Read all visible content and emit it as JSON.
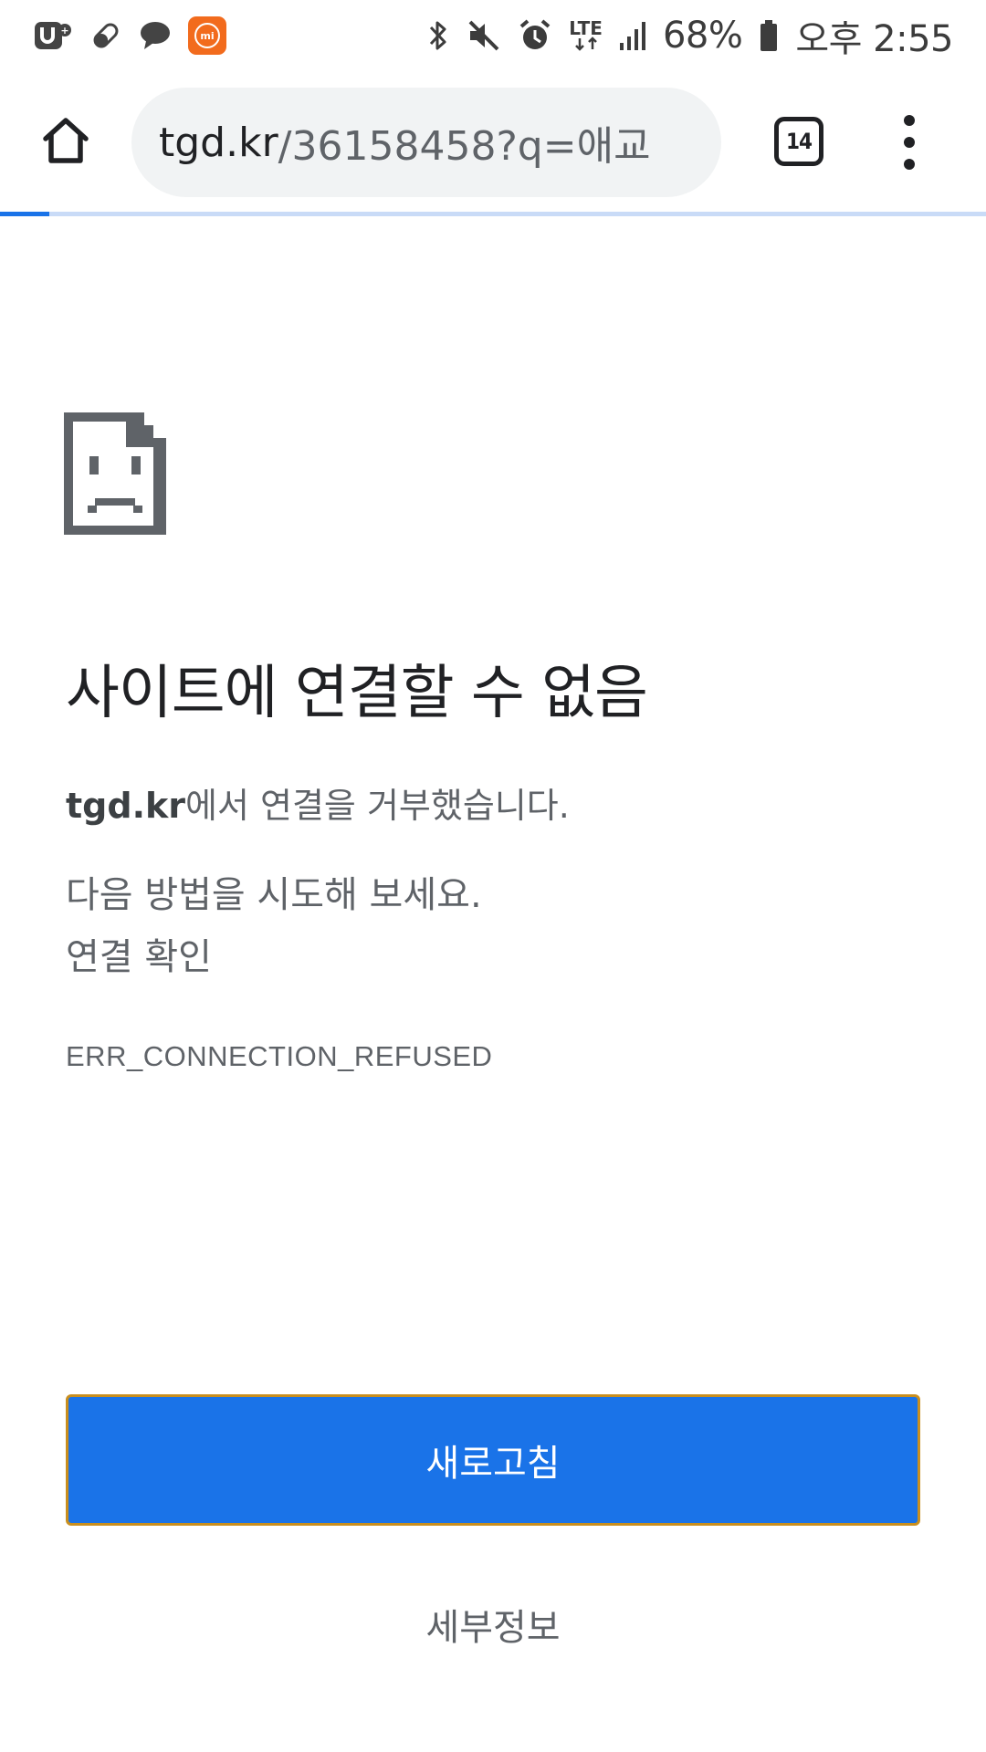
{
  "status_bar": {
    "battery_percent": "68%",
    "time": "오후 2:55",
    "network_type": "LTE",
    "left_icons": [
      "u-plus-app-icon",
      "pill-icon",
      "chat-bubble-icon",
      "mi-app-icon"
    ],
    "right_icons": [
      "bluetooth-icon",
      "mute-icon",
      "alarm-icon",
      "lte-data-icon",
      "signal-icon",
      "battery-icon"
    ]
  },
  "toolbar": {
    "url_host": "tgd.kr",
    "url_path": "/36158458?q=애교",
    "tab_count": "14"
  },
  "page_load_progress": 0.05,
  "error_page": {
    "title": "사이트에 연결할 수 없음",
    "detail_host": "tgd.kr",
    "detail_text": "에서 연결을 거부했습니다.",
    "suggest_heading": "다음 방법을 시도해 보세요.",
    "suggestions": [
      "연결 확인"
    ],
    "error_code": "ERR_CONNECTION_REFUSED",
    "reload_label": "새로고침",
    "details_label": "세부정보"
  },
  "colors": {
    "accent": "#1a73e8",
    "reload_border": "#c98f1f",
    "url_bar_bg": "#f1f3f4",
    "secondary_text": "#5f6368"
  }
}
